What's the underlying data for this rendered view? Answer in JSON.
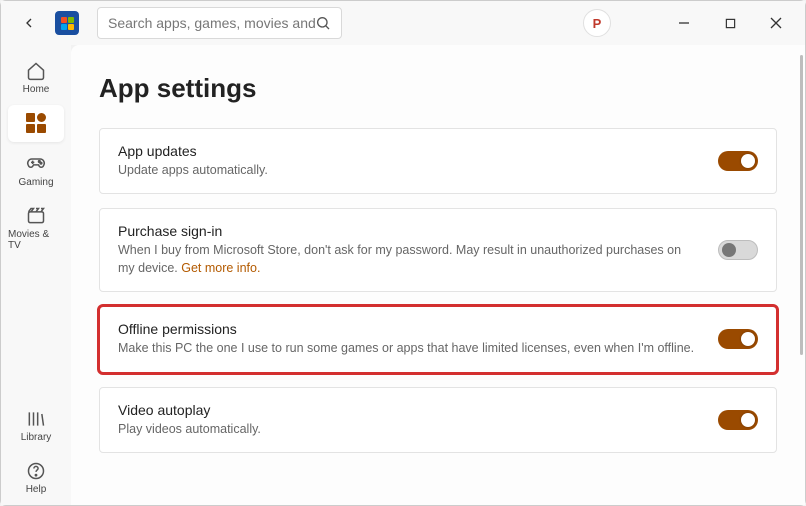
{
  "header": {
    "search_placeholder": "Search apps, games, movies and more",
    "profile_letter": "P"
  },
  "sidebar": {
    "home": "Home",
    "apps": "",
    "gaming": "Gaming",
    "movies": "Movies & TV",
    "library": "Library",
    "help": "Help"
  },
  "page": {
    "title": "App settings"
  },
  "settings": {
    "app_updates": {
      "title": "App updates",
      "desc": "Update apps automatically.",
      "on": true
    },
    "purchase_signin": {
      "title": "Purchase sign-in",
      "desc": "When I buy from Microsoft Store, don't ask for my password. May result in unauthorized purchases on my device. ",
      "link": "Get more info.",
      "on": false
    },
    "offline_permissions": {
      "title": "Offline permissions",
      "desc": "Make this PC the one I use to run some games or apps that have limited licenses, even when I'm offline.",
      "on": true
    },
    "video_autoplay": {
      "title": "Video autoplay",
      "desc": "Play videos automatically.",
      "on": true
    }
  }
}
